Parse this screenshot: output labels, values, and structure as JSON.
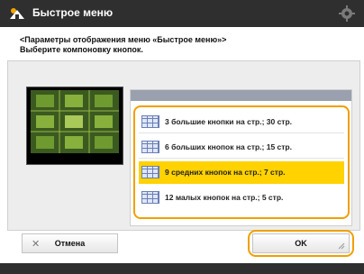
{
  "window": {
    "title": "Быстрое меню"
  },
  "prompt": {
    "line1": "<Параметры отображения меню «Быстрое меню»>",
    "line2": "Выберите компоновку кнопок."
  },
  "options": [
    {
      "label": "3 большие кнопки на стр.; 30 стр.",
      "selected": false
    },
    {
      "label": "6 больших кнопок на стр.; 15 стр.",
      "selected": false
    },
    {
      "label": "9 средних кнопок на стр.; 7 стр.",
      "selected": true
    },
    {
      "label": "12 малых кнопок на стр.; 5 стр.",
      "selected": false
    }
  ],
  "buttons": {
    "cancel_label": "Отмена",
    "ok_label": "OK"
  },
  "icons": {
    "home": "home-icon",
    "settings": "gear-icon",
    "grid": "grid-icon"
  },
  "colors": {
    "accent": "#f0a000",
    "selected": "#ffd200",
    "titlebar": "#2f2f2f"
  }
}
